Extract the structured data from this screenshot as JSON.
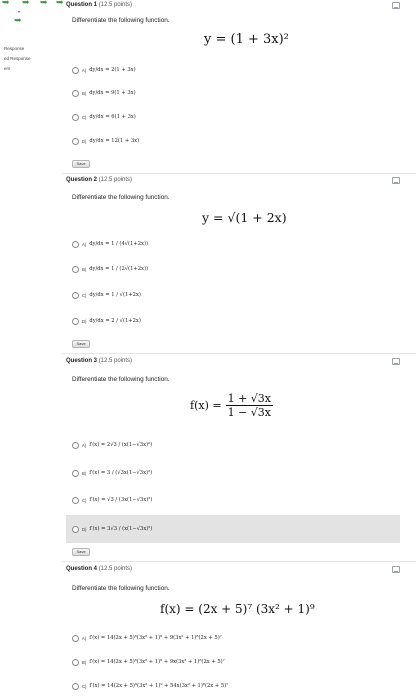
{
  "sidebar": {
    "labels": [
      "Response",
      "ed Response",
      "ers"
    ]
  },
  "questions": [
    {
      "title": "Question 1",
      "points": "(12.5 points)",
      "prompt": "Differentiate the following function.",
      "equation": "y = (1 + 3x)²",
      "options": [
        {
          "letter": "A)",
          "text": "dy/dx = 2(1 + 3x)"
        },
        {
          "letter": "B)",
          "text": "dy/dx = 9(1 + 3x)"
        },
        {
          "letter": "C)",
          "text": "dy/dx = 6(1 + 3x)"
        },
        {
          "letter": "D)",
          "text": "dy/dx = 12(1 + 3x)"
        }
      ],
      "save_label": "Save"
    },
    {
      "title": "Question 2",
      "points": "(12.5 points)",
      "prompt": "Differentiate the following function.",
      "equation": "y = √(1 + 2x)",
      "options": [
        {
          "letter": "A)",
          "text": "dy/dx = 1 / (4√(1+2x))"
        },
        {
          "letter": "B)",
          "text": "dy/dx = 1 / (2√(1+2x))"
        },
        {
          "letter": "C)",
          "text": "dy/dx = 1 / √(1+2x)"
        },
        {
          "letter": "D)",
          "text": "dy/dx = 2 / √(1+2x)"
        }
      ],
      "save_label": "Save"
    },
    {
      "title": "Question 3",
      "points": "(12.5 points)",
      "prompt": "Differentiate the following function.",
      "equation_lhs": "f(x) =",
      "equation_num": "1 + √3x",
      "equation_den": "1 − √3x",
      "options": [
        {
          "letter": "A)",
          "text": "f′(x) = 2√3 / (x(1−√3x)²)"
        },
        {
          "letter": "B)",
          "text": "f′(x) = 3 / (√3x(1−√3x)²)"
        },
        {
          "letter": "C)",
          "text": "f′(x) = √3 / (3x(1−√3x)²)"
        },
        {
          "letter": "D)",
          "text": "f′(x) = 3√3 / (x(1−√3x)²)"
        }
      ],
      "save_label": "Save"
    },
    {
      "title": "Question 4",
      "points": "(12.5 points)",
      "prompt": "Differentiate the following function.",
      "equation": "f(x) = (2x + 5)⁷ (3x² + 1)⁹",
      "options": [
        {
          "letter": "A)",
          "text": "f′(x) = 14(2x + 5)⁶(3x² + 1)⁹ + 9(3x² + 1)⁸(2x + 5)⁷"
        },
        {
          "letter": "B)",
          "text": "f′(x) = 14(2x + 5)⁶(3x² + 1)⁹ + 9x(3x² + 1)⁸(2x + 5)⁷"
        },
        {
          "letter": "C)",
          "text": "f′(x) = 14(2x + 5)⁶(3x² + 1)⁹ + 54x(3x² + 1)⁸(2x + 5)⁷"
        }
      ]
    }
  ],
  "colors": {
    "accent_green": "#3d9a3d",
    "selected_row": "#e3e3e3"
  },
  "selected": {
    "question": 3,
    "option": "D)"
  }
}
